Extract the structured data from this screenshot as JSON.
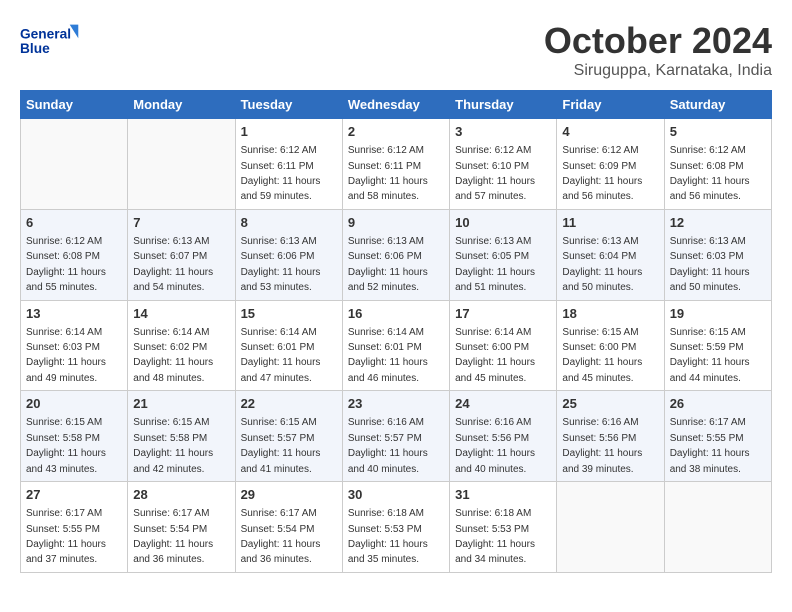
{
  "header": {
    "logo_line1": "General",
    "logo_line2": "Blue",
    "title": "October 2024",
    "subtitle": "Siruguppa, Karnataka, India"
  },
  "columns": [
    "Sunday",
    "Monday",
    "Tuesday",
    "Wednesday",
    "Thursday",
    "Friday",
    "Saturday"
  ],
  "weeks": [
    [
      {
        "day": "",
        "empty": true
      },
      {
        "day": "",
        "empty": true
      },
      {
        "day": "1",
        "sunrise": "6:12 AM",
        "sunset": "6:11 PM",
        "daylight": "11 hours and 59 minutes."
      },
      {
        "day": "2",
        "sunrise": "6:12 AM",
        "sunset": "6:11 PM",
        "daylight": "11 hours and 58 minutes."
      },
      {
        "day": "3",
        "sunrise": "6:12 AM",
        "sunset": "6:10 PM",
        "daylight": "11 hours and 57 minutes."
      },
      {
        "day": "4",
        "sunrise": "6:12 AM",
        "sunset": "6:09 PM",
        "daylight": "11 hours and 56 minutes."
      },
      {
        "day": "5",
        "sunrise": "6:12 AM",
        "sunset": "6:08 PM",
        "daylight": "11 hours and 56 minutes."
      }
    ],
    [
      {
        "day": "6",
        "sunrise": "6:12 AM",
        "sunset": "6:08 PM",
        "daylight": "11 hours and 55 minutes."
      },
      {
        "day": "7",
        "sunrise": "6:13 AM",
        "sunset": "6:07 PM",
        "daylight": "11 hours and 54 minutes."
      },
      {
        "day": "8",
        "sunrise": "6:13 AM",
        "sunset": "6:06 PM",
        "daylight": "11 hours and 53 minutes."
      },
      {
        "day": "9",
        "sunrise": "6:13 AM",
        "sunset": "6:06 PM",
        "daylight": "11 hours and 52 minutes."
      },
      {
        "day": "10",
        "sunrise": "6:13 AM",
        "sunset": "6:05 PM",
        "daylight": "11 hours and 51 minutes."
      },
      {
        "day": "11",
        "sunrise": "6:13 AM",
        "sunset": "6:04 PM",
        "daylight": "11 hours and 50 minutes."
      },
      {
        "day": "12",
        "sunrise": "6:13 AM",
        "sunset": "6:03 PM",
        "daylight": "11 hours and 50 minutes."
      }
    ],
    [
      {
        "day": "13",
        "sunrise": "6:14 AM",
        "sunset": "6:03 PM",
        "daylight": "11 hours and 49 minutes."
      },
      {
        "day": "14",
        "sunrise": "6:14 AM",
        "sunset": "6:02 PM",
        "daylight": "11 hours and 48 minutes."
      },
      {
        "day": "15",
        "sunrise": "6:14 AM",
        "sunset": "6:01 PM",
        "daylight": "11 hours and 47 minutes."
      },
      {
        "day": "16",
        "sunrise": "6:14 AM",
        "sunset": "6:01 PM",
        "daylight": "11 hours and 46 minutes."
      },
      {
        "day": "17",
        "sunrise": "6:14 AM",
        "sunset": "6:00 PM",
        "daylight": "11 hours and 45 minutes."
      },
      {
        "day": "18",
        "sunrise": "6:15 AM",
        "sunset": "6:00 PM",
        "daylight": "11 hours and 45 minutes."
      },
      {
        "day": "19",
        "sunrise": "6:15 AM",
        "sunset": "5:59 PM",
        "daylight": "11 hours and 44 minutes."
      }
    ],
    [
      {
        "day": "20",
        "sunrise": "6:15 AM",
        "sunset": "5:58 PM",
        "daylight": "11 hours and 43 minutes."
      },
      {
        "day": "21",
        "sunrise": "6:15 AM",
        "sunset": "5:58 PM",
        "daylight": "11 hours and 42 minutes."
      },
      {
        "day": "22",
        "sunrise": "6:15 AM",
        "sunset": "5:57 PM",
        "daylight": "11 hours and 41 minutes."
      },
      {
        "day": "23",
        "sunrise": "6:16 AM",
        "sunset": "5:57 PM",
        "daylight": "11 hours and 40 minutes."
      },
      {
        "day": "24",
        "sunrise": "6:16 AM",
        "sunset": "5:56 PM",
        "daylight": "11 hours and 40 minutes."
      },
      {
        "day": "25",
        "sunrise": "6:16 AM",
        "sunset": "5:56 PM",
        "daylight": "11 hours and 39 minutes."
      },
      {
        "day": "26",
        "sunrise": "6:17 AM",
        "sunset": "5:55 PM",
        "daylight": "11 hours and 38 minutes."
      }
    ],
    [
      {
        "day": "27",
        "sunrise": "6:17 AM",
        "sunset": "5:55 PM",
        "daylight": "11 hours and 37 minutes."
      },
      {
        "day": "28",
        "sunrise": "6:17 AM",
        "sunset": "5:54 PM",
        "daylight": "11 hours and 36 minutes."
      },
      {
        "day": "29",
        "sunrise": "6:17 AM",
        "sunset": "5:54 PM",
        "daylight": "11 hours and 36 minutes."
      },
      {
        "day": "30",
        "sunrise": "6:18 AM",
        "sunset": "5:53 PM",
        "daylight": "11 hours and 35 minutes."
      },
      {
        "day": "31",
        "sunrise": "6:18 AM",
        "sunset": "5:53 PM",
        "daylight": "11 hours and 34 minutes."
      },
      {
        "day": "",
        "empty": true
      },
      {
        "day": "",
        "empty": true
      }
    ]
  ]
}
